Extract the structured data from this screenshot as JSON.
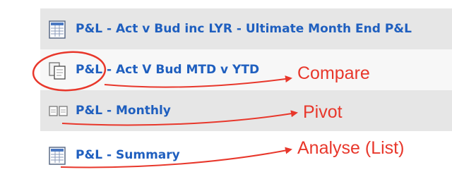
{
  "reports": [
    {
      "label": "P&L - Act v Bud inc LYR - Ultimate Month End P&L",
      "icon": "grid-report-icon"
    },
    {
      "label": "P&L - Act V Bud MTD v YTD",
      "icon": "compare-docs-icon"
    },
    {
      "label": "P&L - Monthly",
      "icon": "pivot-docs-icon"
    },
    {
      "label": "P&L - Summary",
      "icon": "grid-report-icon"
    }
  ],
  "annotations": {
    "compare": "Compare",
    "pivot": "Pivot",
    "analyse": "Analyse (List)"
  },
  "colors": {
    "link": "#1f5fbf",
    "annotation": "#e8372b",
    "row_dark": "#e6e6e6",
    "row_light": "#f7f7f7"
  }
}
